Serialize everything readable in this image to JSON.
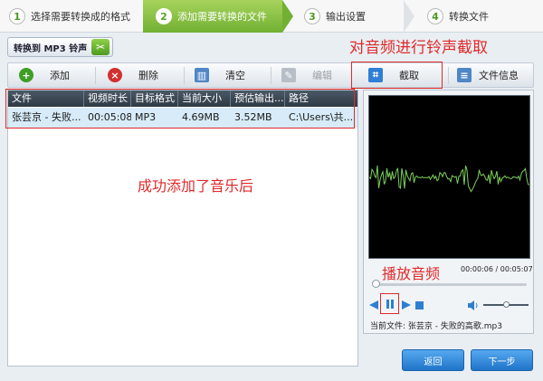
{
  "steps": [
    {
      "num": "1",
      "label": "选择需要转换成的格式"
    },
    {
      "num": "2",
      "label": "添加需要转换的文件"
    },
    {
      "num": "3",
      "label": "输出设置"
    },
    {
      "num": "4",
      "label": "转换文件"
    }
  ],
  "mode": {
    "label": "转换到 MP3 铃声"
  },
  "toolbar": {
    "add": "添加",
    "delete": "删除",
    "clear": "清空",
    "edit": "编辑",
    "crop": "截取",
    "info": "文件信息"
  },
  "table": {
    "headers": [
      "文件",
      "视频时长",
      "目标格式",
      "当前大小",
      "预估输出...",
      "路径"
    ],
    "rows": [
      [
        "张芸京 - 失败...",
        "00:05:08",
        "MP3",
        "4.69MB",
        "3.52MB",
        "C:\\Users\\共..."
      ]
    ]
  },
  "annotations": {
    "crop_note": "对音频进行铃声截取",
    "added_note": "成功添加了音乐后",
    "play_note": "播放音频"
  },
  "preview": {
    "time_current": "00:00:06",
    "time_separator": "/",
    "time_total": "00:05:07",
    "progress": 0.02,
    "volume": 0.45,
    "current_file_label": "当前文件:",
    "current_file_name": "张芸京 - 失败的高歌.mp3"
  },
  "footer": {
    "back": "返回",
    "next": "下一步"
  },
  "colors": {
    "accent_green": "#71b032",
    "annotation_red": "#e02a2a",
    "button_blue": "#1f74c8",
    "waveform": "#7cd15a"
  }
}
